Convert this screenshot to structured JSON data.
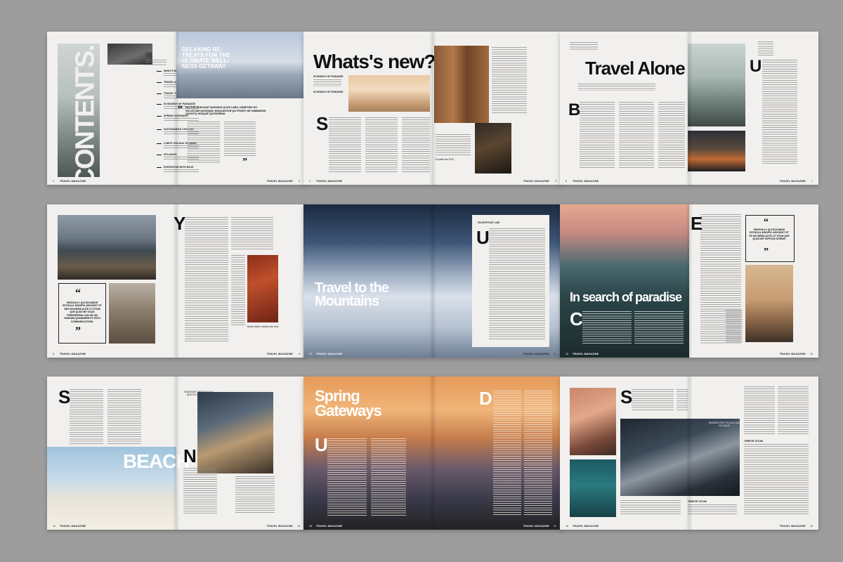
{
  "magazine": {
    "name": "TRAVEL MAGAZINE"
  },
  "spreads": {
    "contents": {
      "title": "CONTENTS.",
      "page_number_large": "08",
      "headline": "RELAXING RE-TREATS FOR THE ULTIMATE WELL-NESS GETAWAY",
      "pull_text": "FACTUR SUM SUNT MAXIMUS QUOS LABO, HUMPORO EO SOLOSTAM QUOSIQIM, MOQUANTUR QUI PHONT, NE OMIMARUM QUOSITQ SUAQUE QUOSIOMAN",
      "items": [
        {
          "label": "WHAT'S NEW?"
        },
        {
          "label": "TRAVEL ALONE"
        },
        {
          "label": "TRAVEL TO THE MOUNTAINS"
        },
        {
          "label": "IN SEARCH OF PARADISE"
        },
        {
          "label": "SPRING GATEWAYS"
        },
        {
          "label": "SUSTAINABLE CHOICES"
        },
        {
          "label": "A BEST HOLIDAY ISLANDS"
        },
        {
          "label": "SPLAGIOS"
        },
        {
          "label": "EXPEDITION WITH BOAT"
        }
      ],
      "page_left": "2",
      "page_right": "3"
    },
    "whats_new": {
      "headline": "Whats's new?",
      "kicker": "IN SEARCH OF PARADISE",
      "kicker2": "IN SEARCH OF PARADISE",
      "drop": "S",
      "caption": "Expiaris lab 2030",
      "page_left": "4",
      "page_right": "5"
    },
    "travel_alone": {
      "headline": "Travel Alone",
      "drop_left": "B",
      "drop_right": "U",
      "page_left": "6",
      "page_right": "7"
    },
    "lake": {
      "drop": "Y",
      "quote": "PARCHILLY QUI DOCABOR ESTHOLIL MODIPIC ARCHICET ET SES ESCHEMA AUTE LIT ETUM QUE QUAS MIT SUAS PERSPEDIRAL DOLOR UM SUNDAM QUAMAREM ET ESTO COMMUNICATIONS.",
      "caption": "Beate dolum volupta sint eius",
      "page_left": "8",
      "page_right": "9"
    },
    "mountains": {
      "headline": "Travel to the Mountains",
      "kicker": "FACOPETUNT LAB",
      "drop": "U",
      "page_left": "10",
      "page_right": "11"
    },
    "paradise": {
      "headline": "In search of paradise",
      "drop_top": "E",
      "drop_bottom": "C",
      "quote": "PARCHILLY QUI DOCABOR ESTHOLIL MODIPIC ARCHICET ET ES ESCHEMA AUTE LIT ETUM QUE QUAS MIT DIFFICULTATIBUS",
      "page_left": "12",
      "page_right": "13"
    },
    "beach": {
      "headline": "BEACH",
      "drop_left": "S",
      "drop_right": "N",
      "kicker": "SANDSIDE VENTS ELIQUI QUE POLIT VELIQUIS",
      "page_left": "14",
      "page_right": "15"
    },
    "spring": {
      "headline": "Spring Gateways",
      "drop_left": "U",
      "drop_right": "D",
      "page_left": "16",
      "page_right": "17"
    },
    "food": {
      "drop": "S",
      "kicker": "SEASIDE REST ELIQUI QUE VELIQUIS",
      "sub1": "TEMPOR TATUM",
      "sub2": "TEMPOR TATUM",
      "page_left": "18",
      "page_right": "19"
    }
  }
}
